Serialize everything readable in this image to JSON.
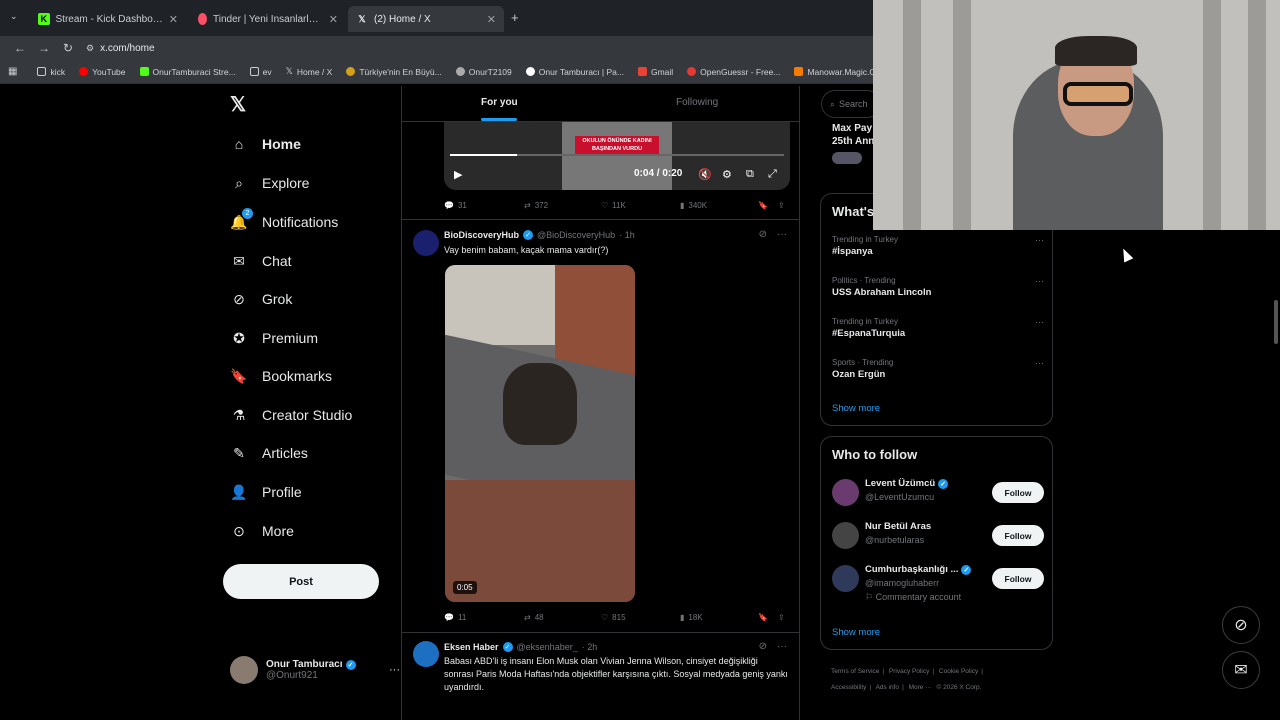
{
  "browser": {
    "tabs": [
      {
        "title": "Stream - Kick Dashboard",
        "icon": "kick-icon",
        "active": false
      },
      {
        "title": "Tinder | Yeni İnsanlarla Tanış, İl...",
        "icon": "tinder-icon",
        "active": false
      },
      {
        "title": "(2) Home / X",
        "icon": "x-logo-icon",
        "active": true
      }
    ],
    "new_tab": "+",
    "url": "x.com/home",
    "bookmarks": [
      {
        "label": "kick",
        "icon": "folder-icon"
      },
      {
        "label": "YouTube",
        "icon": "youtube-icon"
      },
      {
        "label": "OnurTamburaci Stre...",
        "icon": "kick-icon"
      },
      {
        "label": "ev",
        "icon": "folder-icon"
      },
      {
        "label": "Home / X",
        "icon": "x-logo-icon"
      },
      {
        "label": "Türkiye'nin En Büyü...",
        "icon": "site-icon"
      },
      {
        "label": "OnurT2109",
        "icon": "site-icon"
      },
      {
        "label": "Onur Tamburacı | Pa...",
        "icon": "site-icon"
      },
      {
        "label": "Gmail",
        "icon": "gmail-icon"
      },
      {
        "label": "OpenGuessr - Free...",
        "icon": "site-icon"
      },
      {
        "label": "Manowar.Magic.Cir...",
        "icon": "site-icon"
      }
    ]
  },
  "nav": {
    "logo": "𝕏",
    "items": [
      {
        "label": "Home",
        "icon": "home-icon",
        "glyph": "⌂",
        "bold": true
      },
      {
        "label": "Explore",
        "icon": "search-icon",
        "glyph": "⌕"
      },
      {
        "label": "Notifications",
        "icon": "bell-icon",
        "glyph": "🔔",
        "badge": "2"
      },
      {
        "label": "Chat",
        "icon": "mail-icon",
        "glyph": "✉"
      },
      {
        "label": "Grok",
        "icon": "grok-icon",
        "glyph": "⊘"
      },
      {
        "label": "Premium",
        "icon": "verified-icon",
        "glyph": "✪"
      },
      {
        "label": "Bookmarks",
        "icon": "bookmark-icon",
        "glyph": "🔖"
      },
      {
        "label": "Creator Studio",
        "icon": "flask-icon",
        "glyph": "⚗"
      },
      {
        "label": "Articles",
        "icon": "article-icon",
        "glyph": "✎"
      },
      {
        "label": "Profile",
        "icon": "person-icon",
        "glyph": "👤"
      },
      {
        "label": "More",
        "icon": "more-circle-icon",
        "glyph": "⊙"
      }
    ],
    "post_label": "Post",
    "account": {
      "name": "Onur Tamburacı",
      "handle": "@Onurt921",
      "more": "···"
    }
  },
  "timeline": {
    "tabs": [
      "For you",
      "Following"
    ],
    "video1": {
      "caption": "OKULUN ÖNÜNDE KADINI BAŞINDAN VURDU",
      "time": "0:04 / 0:20",
      "progress": 0.2,
      "actions": {
        "replies": "31",
        "reposts": "372",
        "likes": "11K",
        "views": "340K"
      }
    },
    "tweets": [
      {
        "name": "BioDiscoveryHub",
        "handle": "@BioDiscoveryHub",
        "time": "· 1h",
        "text": "Vay benim babam, kaçak mama vardır(?)",
        "duration": "0:05",
        "actions": {
          "replies": "11",
          "reposts": "48",
          "likes": "815",
          "views": "18K"
        }
      },
      {
        "name": "Eksen Haber",
        "handle": "@eksenhaber_",
        "time": "· 2h",
        "text": "Babası ABD'li iş insanı Elon Musk olan Vivian Jenna Wilson, cinsiyet değişikliği sonrası Paris Moda Haftası'nda objektifler karşısına çıktı. Sosyal medyada geniş yankı uyandırdı."
      }
    ]
  },
  "right": {
    "search_placeholder": "Search",
    "event_lines": [
      "Max Pay",
      "25th Ann"
    ],
    "trends_title": "What's",
    "trends": [
      {
        "meta": "Trending in Turkey",
        "name": "#İspanya"
      },
      {
        "meta": "Politics · Trending",
        "name": "USS Abraham Lincoln"
      },
      {
        "meta": "Trending in Turkey",
        "name": "#EspanaTurquia"
      },
      {
        "meta": "Sports · Trending",
        "name": "Ozan Ergün"
      }
    ],
    "show_more": "Show more",
    "who_title": "Who to follow",
    "who": [
      {
        "name": "Levent Üzümcü",
        "handle": "@LeventUzumcu",
        "verified": true
      },
      {
        "name": "Nur Betül Aras",
        "handle": "@nurbetularas",
        "verified": false
      },
      {
        "name": "Cumhurbaşkanlığı ...",
        "handle": "@imamogluhaberr",
        "verified": true,
        "extra": "Commentary account"
      }
    ],
    "follow_label": "Follow",
    "footer": [
      "Terms of Service",
      "|",
      "Privacy Policy",
      "|",
      "Cookie Policy",
      "|",
      "Accessibility",
      "|",
      "Ads info",
      "|",
      "More ···",
      "© 2026 X Corp."
    ]
  }
}
